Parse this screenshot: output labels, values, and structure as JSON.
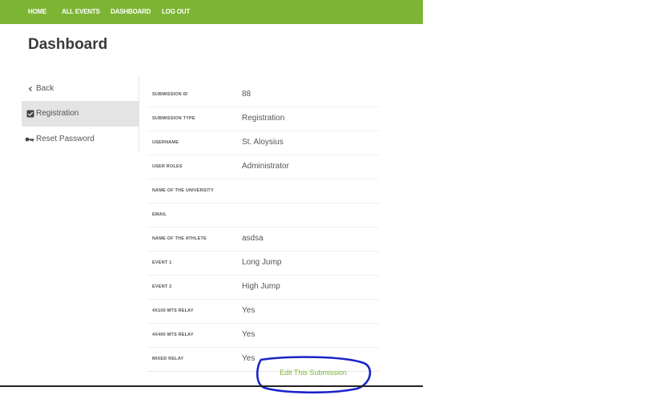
{
  "nav": {
    "items": [
      {
        "label": "HOME"
      },
      {
        "label": "ALL EVENTS"
      },
      {
        "label": "DASHBOARD"
      },
      {
        "label": "LOG OUT"
      }
    ]
  },
  "page": {
    "title": "Dashboard"
  },
  "sidebar": {
    "items": [
      {
        "label": "Back",
        "icon": "chevron-left-icon"
      },
      {
        "label": "Registration",
        "icon": "checkbox-icon",
        "active": true
      },
      {
        "label": "Reset Password",
        "icon": "key-icon"
      }
    ]
  },
  "submission": {
    "rows": [
      {
        "label": "SUBMISSION ID",
        "value": "88"
      },
      {
        "label": "SUBMISSION TYPE",
        "value": "Registration"
      },
      {
        "label": "USERNAME",
        "value": "St. Aloysius"
      },
      {
        "label": "USER ROLES",
        "value": "Administrator"
      },
      {
        "label": "NAME OF THE UNIVERSITY",
        "value": ""
      },
      {
        "label": "EMAIL",
        "value": ""
      },
      {
        "label": "NAME OF THE ATHLETE",
        "value": "asdsa"
      },
      {
        "label": "EVENT 1",
        "value": "Long Jump"
      },
      {
        "label": "EVENT 2",
        "value": "High Jump"
      },
      {
        "label": "4X100 MTS RELAY",
        "value": "Yes"
      },
      {
        "label": "4X400 MTS RELAY",
        "value": "Yes"
      },
      {
        "label": "MIXED RELAY",
        "value": "Yes"
      }
    ]
  },
  "actions": {
    "edit_label": "Edit This Submission"
  },
  "colors": {
    "accent": "#7cb534",
    "annotation": "#1a23c8"
  }
}
